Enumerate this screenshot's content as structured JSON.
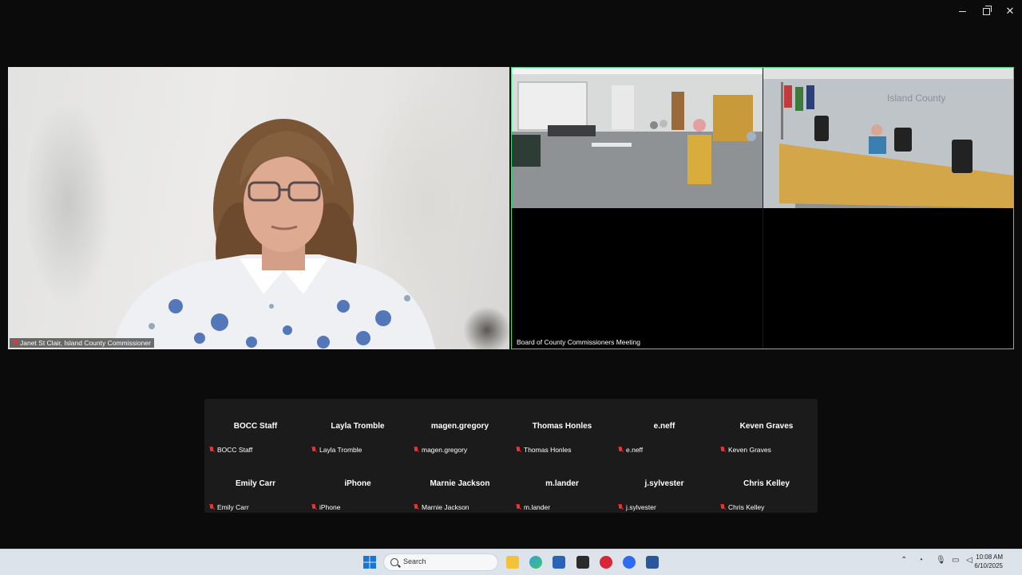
{
  "window": {
    "minimize": "—",
    "restore": "❐",
    "close": "✕"
  },
  "speaker": {
    "name_tag": "Janet St Clair, Island County Commissioner"
  },
  "room_feed": {
    "name_tag": "Board of County Commissioners Meeting",
    "wall_sign": "Island County"
  },
  "participants": [
    {
      "name": "BOCC Staff",
      "label": "BOCC Staff"
    },
    {
      "name": "Layla Tromble",
      "label": "Layla Tromble"
    },
    {
      "name": "magen.gregory",
      "label": "magen.gregory"
    },
    {
      "name": "Thomas Honles",
      "label": "Thomas Honles"
    },
    {
      "name": "e.neff",
      "label": "e.neff"
    },
    {
      "name": "Keven Graves",
      "label": "Keven Graves"
    },
    {
      "name": "Emily Carr",
      "label": "Emily Carr"
    },
    {
      "name": "iPhone",
      "label": "iPhone"
    },
    {
      "name": "Marnie Jackson",
      "label": "Marnie Jackson"
    },
    {
      "name": "m.lander",
      "label": "m.lander"
    },
    {
      "name": "j.sylvester",
      "label": "j.sylvester"
    },
    {
      "name": "Chris Kelley",
      "label": "Chris Kelley"
    }
  ],
  "taskbar": {
    "search_placeholder": "Search",
    "time": "10:08 AM",
    "date": "6/10/2025"
  },
  "colors": {
    "active_border": "#2ee27a",
    "muted": "#e33333",
    "taskbar_bg": "#dde3ea"
  }
}
